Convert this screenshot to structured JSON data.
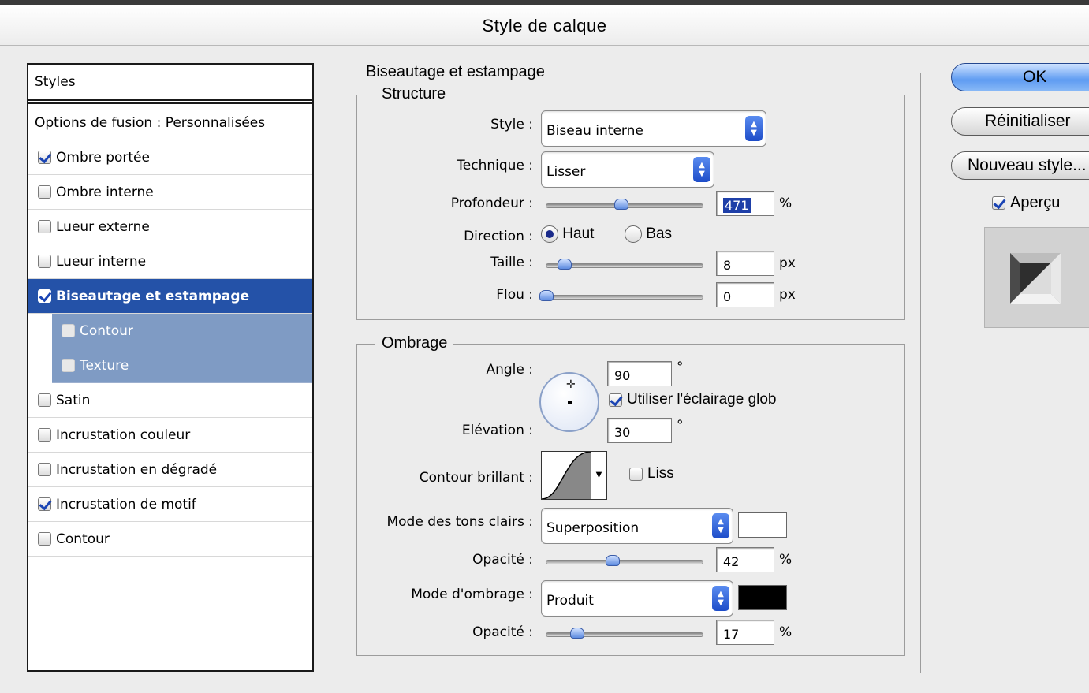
{
  "window": {
    "title": "Style de calque"
  },
  "styles_panel": {
    "header": "Styles",
    "fusion": "Options de fusion : Personnalisées",
    "items": [
      {
        "label": "Ombre portée",
        "checked": true
      },
      {
        "label": "Ombre interne",
        "checked": false
      },
      {
        "label": "Lueur externe",
        "checked": false
      },
      {
        "label": "Lueur interne",
        "checked": false
      },
      {
        "label": "Biseautage et estampage",
        "checked": true,
        "selected": true
      },
      {
        "label": "Contour",
        "checked": false,
        "sub": true
      },
      {
        "label": "Texture",
        "checked": false,
        "sub": true
      },
      {
        "label": "Satin",
        "checked": false
      },
      {
        "label": "Incrustation couleur",
        "checked": false
      },
      {
        "label": "Incrustation en dégradé",
        "checked": false
      },
      {
        "label": "Incrustation de motif",
        "checked": true
      },
      {
        "label": "Contour",
        "checked": false
      }
    ]
  },
  "bevel": {
    "legend": "Biseautage et estampage",
    "structure": {
      "legend": "Structure",
      "style_label": "Style :",
      "style_value": "Biseau interne",
      "technique_label": "Technique :",
      "technique_value": "Lisser",
      "depth_label": "Profondeur :",
      "depth_value": "471",
      "depth_unit": "%",
      "depth_slider": 0.48,
      "direction_label": "Direction :",
      "direction_up": "Haut",
      "direction_down": "Bas",
      "size_label": "Taille :",
      "size_value": "8",
      "size_unit": "px",
      "size_slider": 0.08,
      "blur_label": "Flou :",
      "blur_value": "0",
      "blur_unit": "px",
      "blur_slider": 0.0
    },
    "shading": {
      "legend": "Ombrage",
      "angle_label": "Angle :",
      "angle_value": "90",
      "angle_unit": "°",
      "global_light_label": "Utiliser l'éclairage glob",
      "global_light_checked": true,
      "elevation_label": "Elévation :",
      "elevation_value": "30",
      "elevation_unit": "°",
      "gloss_label": "Contour brillant :",
      "antialias_label": "Liss",
      "highlight_mode_label": "Mode des tons clairs :",
      "highlight_mode_value": "Superposition",
      "highlight_color": "#ffffff",
      "highlight_opacity_label": "Opacité :",
      "highlight_opacity_value": "42",
      "highlight_opacity_unit": "%",
      "highlight_opacity_slider": 0.42,
      "shadow_mode_label": "Mode d'ombrage :",
      "shadow_mode_value": "Produit",
      "shadow_color": "#000000",
      "shadow_opacity_label": "Opacité :",
      "shadow_opacity_value": "17",
      "shadow_opacity_unit": "%",
      "shadow_opacity_slider": 0.17
    }
  },
  "buttons": {
    "ok": "OK",
    "reset": "Réinitialiser",
    "new_style": "Nouveau style...",
    "preview_label": "Aperçu",
    "preview_checked": true
  },
  "colors": {
    "accent": "#2452a8",
    "sub_item": "#7f9bc4"
  }
}
